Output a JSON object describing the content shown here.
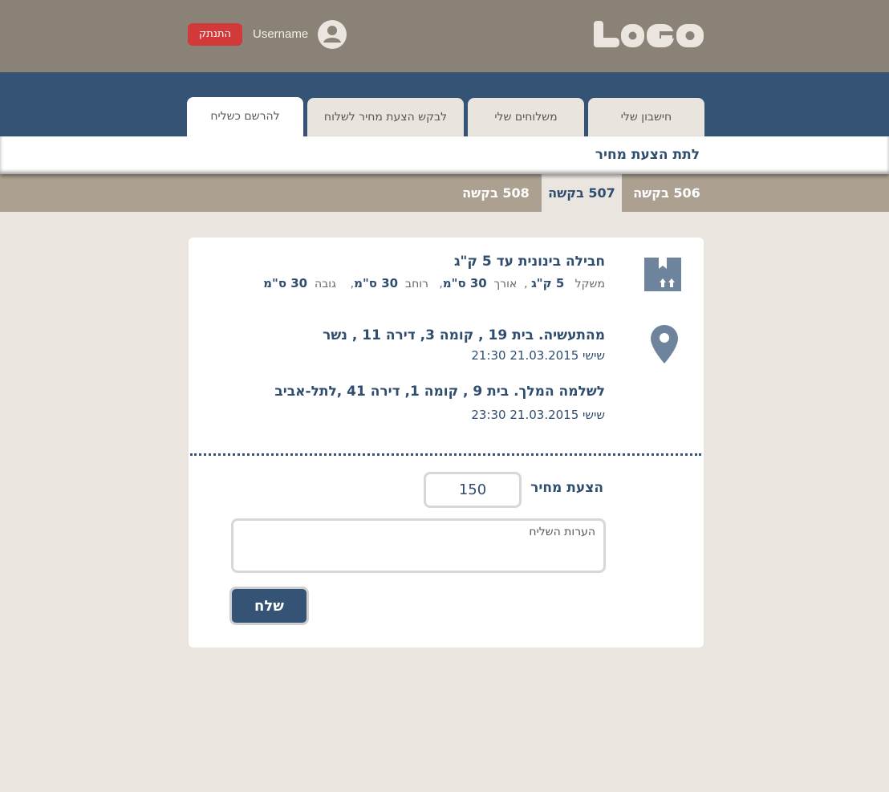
{
  "header": {
    "logo_text": "LOGO",
    "username": "Username",
    "logout_label": "התנתק"
  },
  "nav": {
    "tabs": [
      {
        "label": "חישבון שלי"
      },
      {
        "label": "משלוחים שלי"
      },
      {
        "label": "לבקש הצעת מחיר לשלוח"
      },
      {
        "label": "להרשם כשליח",
        "active": true
      }
    ]
  },
  "subheader": {
    "title": "לתת הצעת מחיר"
  },
  "requests": {
    "tabs": [
      {
        "label": "506 בקשה"
      },
      {
        "label": "507 בקשה",
        "active": true
      },
      {
        "label": "508 בקשה"
      }
    ]
  },
  "package": {
    "title": "חבילה בינונית עד 5 ק\"ג",
    "weight_label": "משקל",
    "weight": "5 ק\"ג",
    "length_label": "אורך",
    "length": "30 ס\"מ",
    "width_label": "רוחב",
    "width": "30 ס\"מ",
    "height_label": "גובה",
    "height": "30 ס\"מ"
  },
  "route": {
    "from_address": "מהתעשיה. בית 19 , קומה 3,  דירה 11  , נשר",
    "from_time": "שישי  21.03.2015  21:30",
    "to_address": "לשלמה המלך. בית 9 , קומה 1,   דירה 41  ,לתל-אביב",
    "to_time": "שישי  21.03.2015  23:30"
  },
  "form": {
    "offer_label": "הצעת מחיר",
    "offer_value": "150",
    "notes_placeholder": "הערות השליח",
    "send_label": "שלח"
  },
  "colors": {
    "header_bg": "#8b8277",
    "nav_bg": "#345375",
    "accent_text": "#2f4d6e",
    "logout_red": "#d23a3a",
    "page_bg": "#eae5df"
  }
}
